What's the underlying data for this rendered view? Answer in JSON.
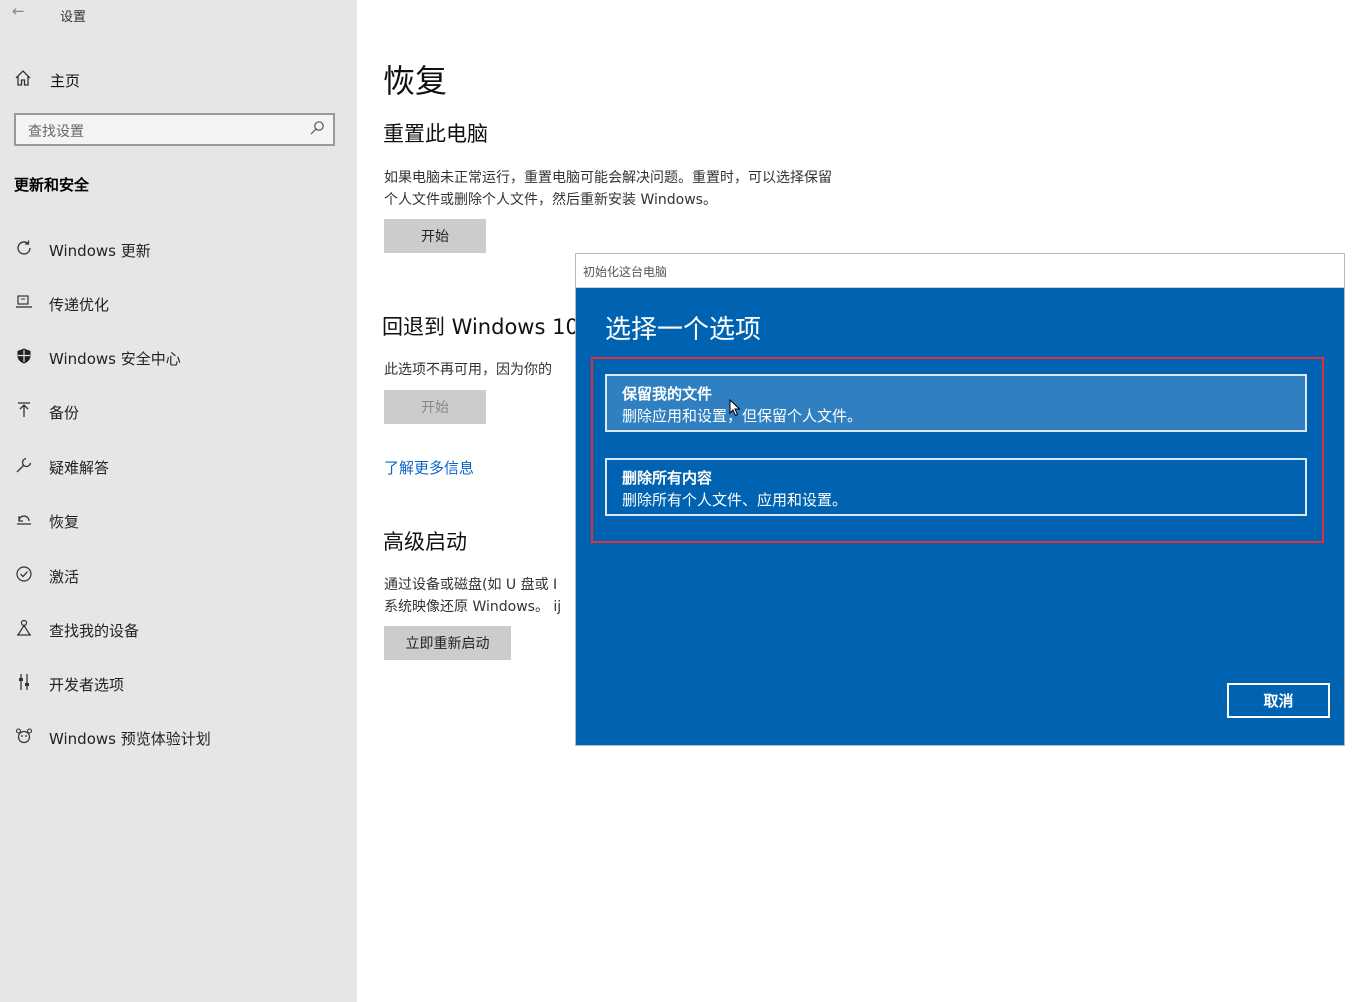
{
  "app": {
    "title": "设置",
    "back_icon": "←"
  },
  "sidebar": {
    "home_label": "主页",
    "search_placeholder": "查找设置",
    "section_title": "更新和安全",
    "items": [
      {
        "label": "Windows 更新",
        "icon": "refresh-icon"
      },
      {
        "label": "传递优化",
        "icon": "delivery-icon"
      },
      {
        "label": "Windows 安全中心",
        "icon": "shield-icon"
      },
      {
        "label": "备份",
        "icon": "backup-icon"
      },
      {
        "label": "疑难解答",
        "icon": "wrench-icon"
      },
      {
        "label": "恢复",
        "icon": "recovery-icon"
      },
      {
        "label": "激活",
        "icon": "check-circle-icon"
      },
      {
        "label": "查找我的设备",
        "icon": "find-device-icon"
      },
      {
        "label": "开发者选项",
        "icon": "developer-icon"
      },
      {
        "label": "Windows 预览体验计划",
        "icon": "insider-icon"
      }
    ]
  },
  "main": {
    "title": "恢复",
    "reset": {
      "heading": "重置此电脑",
      "line1": "如果电脑未正常运行，重置电脑可能会解决问题。重置时，可以选择保留",
      "line2": "个人文件或删除个人文件，然后重新安装 Windows。",
      "button": "开始"
    },
    "rollback": {
      "heading": "回退到 Windows 10",
      "line1": "此选项不再可用，因为你的",
      "button": "开始"
    },
    "learn_more": "了解更多信息",
    "advanced": {
      "heading": "高级启动",
      "line1": "通过设备或磁盘(如 U 盘或 I",
      "line2": "系统映像还原 Windows。 ij",
      "button": "立即重新启动"
    }
  },
  "dialog": {
    "window_title": "初始化这台电脑",
    "heading": "选择一个选项",
    "options": [
      {
        "title": "保留我的文件",
        "desc": "删除应用和设置，但保留个人文件。"
      },
      {
        "title": "删除所有内容",
        "desc": "删除所有个人文件、应用和设置。"
      }
    ],
    "cancel": "取消",
    "highlight_color": "#e0303a",
    "background_color": "#0063b1"
  }
}
